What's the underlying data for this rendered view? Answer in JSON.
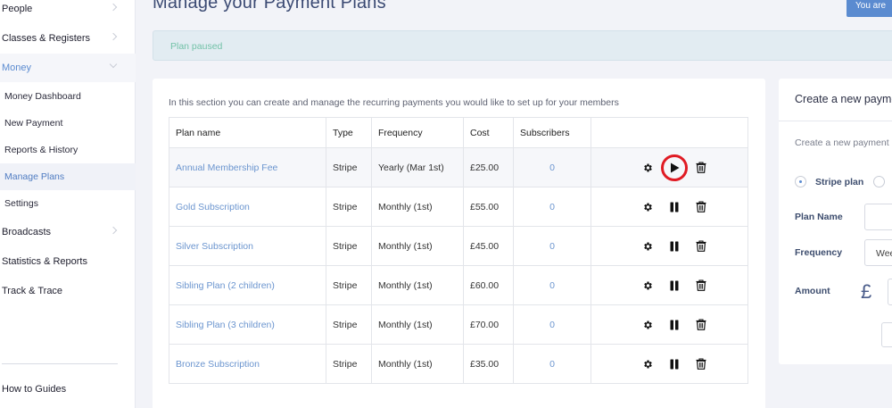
{
  "sidebar": {
    "items": [
      {
        "label": "People"
      },
      {
        "label": "Classes & Registers"
      },
      {
        "label": "Money"
      },
      {
        "label": "Broadcasts"
      },
      {
        "label": "Statistics & Reports"
      },
      {
        "label": "Track & Trace"
      }
    ],
    "money_sub": [
      {
        "label": "Money Dashboard"
      },
      {
        "label": "New Payment"
      },
      {
        "label": "Reports & History"
      },
      {
        "label": "Manage Plans"
      },
      {
        "label": "Settings"
      }
    ],
    "footer": "How to Guides"
  },
  "header": {
    "title": "Manage your Payment Plans",
    "user_button": "You are"
  },
  "alert": "Plan paused",
  "main": {
    "intro": "In this section you can create and manage the recurring payments you would like to set up for your members",
    "columns": [
      "Plan name",
      "Type",
      "Frequency",
      "Cost",
      "Subscribers"
    ],
    "rows": [
      {
        "name": "Annual Membership Fee",
        "type": "Stripe",
        "frequency": "Yearly (Mar 1st)",
        "cost": "£25.00",
        "subscribers": "0",
        "paused": true
      },
      {
        "name": "Gold Subscription",
        "type": "Stripe",
        "frequency": "Monthly (1st)",
        "cost": "£55.00",
        "subscribers": "0",
        "paused": false
      },
      {
        "name": "Silver Subscription",
        "type": "Stripe",
        "frequency": "Monthly (1st)",
        "cost": "£45.00",
        "subscribers": "0",
        "paused": false
      },
      {
        "name": "Sibling Plan (2 children)",
        "type": "Stripe",
        "frequency": "Monthly (1st)",
        "cost": "£60.00",
        "subscribers": "0",
        "paused": false
      },
      {
        "name": "Sibling Plan (3 children)",
        "type": "Stripe",
        "frequency": "Monthly (1st)",
        "cost": "£70.00",
        "subscribers": "0",
        "paused": false
      },
      {
        "name": "Bronze Subscription",
        "type": "Stripe",
        "frequency": "Monthly (1st)",
        "cost": "£35.00",
        "subscribers": "0",
        "paused": false
      }
    ],
    "row_icons": [
      "gear-icon",
      "pause-icon",
      "play-icon",
      "trash-icon"
    ]
  },
  "new_plan": {
    "title": "Create a new payment plan",
    "subtitle": "Create a new payment plan",
    "option_stripe": "Stripe plan",
    "plan_name_label": "Plan Name",
    "frequency_label": "Frequency",
    "frequency_value": "Weekly",
    "amount_label": "Amount",
    "currency_symbol": "£"
  },
  "colors": {
    "accent": "#5b8bd0",
    "link": "#6b95cf",
    "alert_text": "#73c2a8",
    "highlight_ring": "#e01b24"
  }
}
